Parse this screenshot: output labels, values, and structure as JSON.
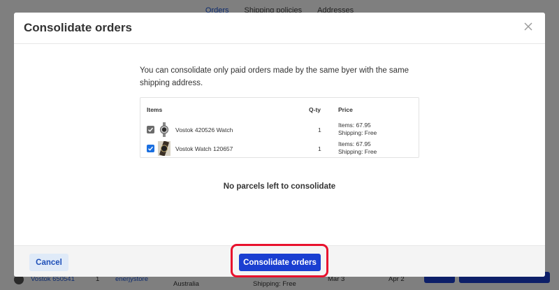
{
  "background": {
    "tabs": [
      "Orders",
      "Shipping policies",
      "Addresses"
    ],
    "row": {
      "item": "Vostok 650541",
      "qty": "1",
      "store": "enerjystore",
      "country": "Australia",
      "shipping": "Shipping: Free",
      "date1": "Mar 3",
      "date2": "Apr 2"
    }
  },
  "modal": {
    "title": "Consolidate orders",
    "intro": "You can consolidate only paid orders made by the same byer with the same shipping address.",
    "table": {
      "columns": {
        "items": "Items",
        "qty": "Q-ty",
        "price": "Price"
      },
      "rows": [
        {
          "name": "Vostok 420526 Watch",
          "qty": "1",
          "items_price": "Items: 67.95",
          "shipping": "Shipping: Free",
          "checked": true,
          "state": "disabled"
        },
        {
          "name": "Vostok Watch 120657",
          "qty": "1",
          "items_price": "Items: 67.95",
          "shipping": "Shipping: Free",
          "checked": true,
          "state": "enabled"
        }
      ]
    },
    "empty_message": "No parcels left to consolidate",
    "footer": {
      "cancel_label": "Cancel",
      "consolidate_label": "Consolidate orders"
    }
  },
  "colors": {
    "primary": "#1a3fd1",
    "highlight": "#e8112d",
    "checkbox_checked": "#1a6fe0"
  },
  "icons": {
    "close": "close-icon",
    "check": "check-icon"
  }
}
